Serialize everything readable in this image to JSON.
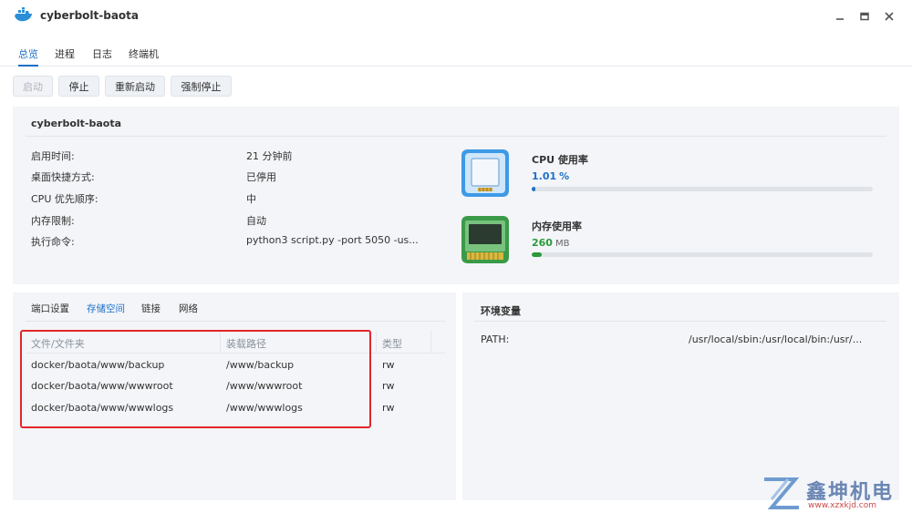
{
  "window": {
    "title": "cyberbolt-baota",
    "icon": "docker-whale-icon"
  },
  "tabs": [
    {
      "label": "总览",
      "active": true
    },
    {
      "label": "进程",
      "active": false
    },
    {
      "label": "日志",
      "active": false
    },
    {
      "label": "终端机",
      "active": false
    }
  ],
  "toolbar": {
    "start_label": "启动",
    "stop_label": "停止",
    "restart_label": "重新启动",
    "force_stop_label": "强制停止"
  },
  "container": {
    "name": "cyberbolt-baota",
    "info": [
      {
        "label": "启用时间:",
        "value": "21 分钟前"
      },
      {
        "label": "桌面快捷方式:",
        "value": "已停用"
      },
      {
        "label": "CPU 优先顺序:",
        "value": "中"
      },
      {
        "label": "内存限制:",
        "value": "自动"
      },
      {
        "label": "执行命令:",
        "value": "python3 script.py -port 5050 -us..."
      }
    ]
  },
  "resources": {
    "cpu": {
      "title": "CPU 使用率",
      "value": "1.01",
      "unit": "%",
      "fraction": 0.0101,
      "color": "#1d6fc8",
      "icon": "cpu-chip-icon"
    },
    "memory": {
      "title": "内存使用率",
      "value": "260",
      "unit": "MB",
      "fraction": 0.03,
      "color": "#2a9a3a",
      "icon": "memory-module-icon"
    }
  },
  "storage": {
    "subtabs": [
      {
        "label": "端口设置",
        "active": false
      },
      {
        "label": "存储空间",
        "active": true
      },
      {
        "label": "链接",
        "active": false
      },
      {
        "label": "网络",
        "active": false
      }
    ],
    "columns": [
      "文件/文件夹",
      "装载路径",
      "类型"
    ],
    "rows": [
      [
        "docker/baota/www/backup",
        "/www/backup",
        "rw"
      ],
      [
        "docker/baota/www/wwwroot",
        "/www/wwwroot",
        "rw"
      ],
      [
        "docker/baota/www/wwwlogs",
        "/www/wwwlogs",
        "rw"
      ]
    ]
  },
  "env": {
    "title": "环境变量",
    "vars": [
      {
        "key": "PATH:",
        "value": "/usr/local/sbin:/usr/local/bin:/usr/..."
      }
    ]
  },
  "watermark": {
    "text": "鑫坤机电",
    "url": "www.xzxkjd.com"
  }
}
